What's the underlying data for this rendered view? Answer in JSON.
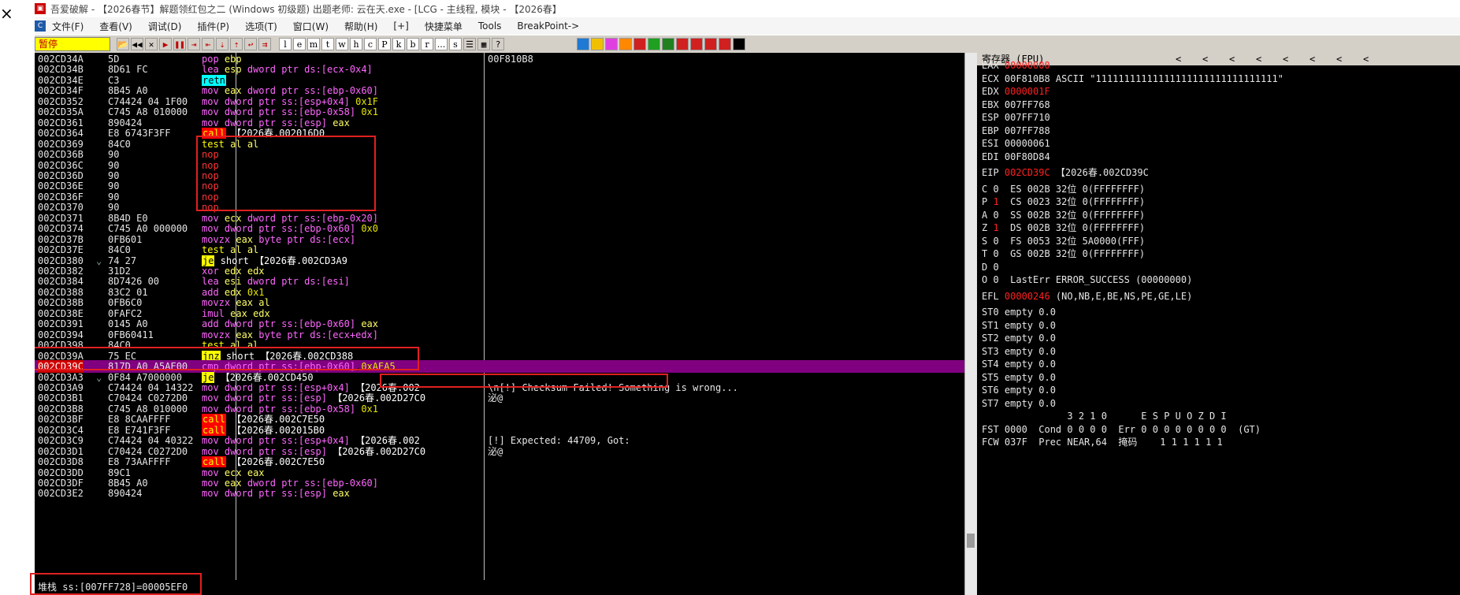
{
  "window": {
    "title": "吾爱破解 - 【2026春节】解题领红包之二 (Windows 初级题) 出题老师: 云在天.exe - [LCG - 主线程, 模块 - 【2026春】"
  },
  "left_close_glyph": "×",
  "menu": {
    "items": [
      "文件(F)",
      "查看(V)",
      "调试(D)",
      "插件(P)",
      "选项(T)",
      "窗口(W)",
      "帮助(H)",
      "[+]",
      "快捷菜单",
      "Tools",
      "BreakPoint->"
    ]
  },
  "toolbar": {
    "status": "暂停",
    "buttons": [
      "📂",
      "◀◀",
      "✕",
      "▶",
      "❚❚",
      "⇥",
      "⇤",
      "⇣",
      "⇡",
      "↩",
      "⇉"
    ],
    "letters": [
      "l",
      "e",
      "m",
      "t",
      "w",
      "h",
      "c",
      "P",
      "k",
      "b",
      "r",
      "...",
      "s"
    ],
    "extra": [
      "☰",
      "▦",
      "?"
    ]
  },
  "cpu": {
    "rows": [
      {
        "addr": "002CD34A",
        "j": "",
        "hex": "5D",
        "mn": "pop",
        "ops": "ebp",
        "cmt": "00F810B8"
      },
      {
        "addr": "002CD34B",
        "j": "",
        "hex": "8D61 FC",
        "mn": "lea",
        "ops": "esp,dword ptr ds:[ecx-0x4]",
        "cmt": ""
      },
      {
        "addr": "002CD34E",
        "j": "",
        "hex": "C3",
        "mn": "retn",
        "ops": "",
        "cmt": ""
      },
      {
        "addr": "002CD34F",
        "j": "",
        "hex": "8B45 A0",
        "mn": "mov",
        "ops": "eax,dword ptr ss:[ebp-0x60]",
        "cmt": ""
      },
      {
        "addr": "002CD352",
        "j": "",
        "hex": "C74424 04 1F00",
        "mn": "mov",
        "ops": "dword ptr ss:[esp+0x4],0x1F",
        "cmt": ""
      },
      {
        "addr": "002CD35A",
        "j": "",
        "hex": "C745 A8 010000",
        "mn": "mov",
        "ops": "dword ptr ss:[ebp-0x58],0x1",
        "cmt": ""
      },
      {
        "addr": "002CD361",
        "j": "",
        "hex": "890424",
        "mn": "mov",
        "ops": "dword ptr ss:[esp],eax",
        "cmt": ""
      },
      {
        "addr": "002CD364",
        "j": "",
        "hex": "E8 6743F3FF",
        "mn": "call",
        "ops": "【2026春.002016D0",
        "cmt": ""
      },
      {
        "addr": "002CD369",
        "j": "",
        "hex": "84C0",
        "mn": "test",
        "ops": "al,al",
        "cmt": ""
      },
      {
        "addr": "002CD36B",
        "j": "",
        "hex": "90",
        "mn": "nop",
        "ops": "",
        "cmt": ""
      },
      {
        "addr": "002CD36C",
        "j": "",
        "hex": "90",
        "mn": "nop",
        "ops": "",
        "cmt": ""
      },
      {
        "addr": "002CD36D",
        "j": "",
        "hex": "90",
        "mn": "nop",
        "ops": "",
        "cmt": ""
      },
      {
        "addr": "002CD36E",
        "j": "",
        "hex": "90",
        "mn": "nop",
        "ops": "",
        "cmt": ""
      },
      {
        "addr": "002CD36F",
        "j": "",
        "hex": "90",
        "mn": "nop",
        "ops": "",
        "cmt": ""
      },
      {
        "addr": "002CD370",
        "j": "",
        "hex": "90",
        "mn": "nop",
        "ops": "",
        "cmt": ""
      },
      {
        "addr": "002CD371",
        "j": "",
        "hex": "8B4D E0",
        "mn": "mov",
        "ops": "ecx,dword ptr ss:[ebp-0x20]",
        "cmt": ""
      },
      {
        "addr": "002CD374",
        "j": "",
        "hex": "C745 A0 000000",
        "mn": "mov",
        "ops": "dword ptr ss:[ebp-0x60],0x0",
        "cmt": ""
      },
      {
        "addr": "002CD37B",
        "j": "",
        "hex": "0FB601",
        "mn": "movzx",
        "ops": "eax,byte ptr ds:[ecx]",
        "cmt": ""
      },
      {
        "addr": "002CD37E",
        "j": "",
        "hex": "84C0",
        "mn": "test",
        "ops": "al,al",
        "cmt": ""
      },
      {
        "addr": "002CD380",
        "j": "⌄",
        "hex": "74 27",
        "mn": "je",
        "ops": "short 【2026春.002CD3A9",
        "cmt": ""
      },
      {
        "addr": "002CD382",
        "j": "",
        "hex": "31D2",
        "mn": "xor",
        "ops": "edx,edx",
        "cmt": ""
      },
      {
        "addr": "002CD384",
        "j": "",
        "hex": "8D7426 00",
        "mn": "lea",
        "ops": "esi,dword ptr ds:[esi]",
        "cmt": ""
      },
      {
        "addr": "002CD388",
        "j": "",
        "hex": "83C2 01",
        "mn": "add",
        "ops": "edx,0x1",
        "cmt": ""
      },
      {
        "addr": "002CD38B",
        "j": "",
        "hex": "0FB6C0",
        "mn": "movzx",
        "ops": "eax,al",
        "cmt": ""
      },
      {
        "addr": "002CD38E",
        "j": "",
        "hex": "0FAFC2",
        "mn": "imul",
        "ops": "eax,edx",
        "cmt": ""
      },
      {
        "addr": "002CD391",
        "j": "",
        "hex": "0145 A0",
        "mn": "add",
        "ops": "dword ptr ss:[ebp-0x60],eax",
        "cmt": ""
      },
      {
        "addr": "002CD394",
        "j": "",
        "hex": "0FB60411",
        "mn": "movzx",
        "ops": "eax,byte ptr ds:[ecx+edx]",
        "cmt": ""
      },
      {
        "addr": "002CD398",
        "j": "",
        "hex": "84C0",
        "mn": "test",
        "ops": "al,al",
        "cmt": ""
      },
      {
        "addr": "002CD39A",
        "j": "",
        "hex": "75 EC",
        "mn": "jnz",
        "ops": "short 【2026春.002CD388",
        "cmt": ""
      },
      {
        "addr": "002CD39C",
        "j": "",
        "hex": "817D A0 A5AE00",
        "mn": "cmp",
        "ops": "dword ptr ss:[ebp-0x60],0xAEA5",
        "cmt": ""
      },
      {
        "addr": "002CD3A3",
        "j": "⌄",
        "hex": "0F84 A7000000",
        "mn": "je",
        "ops": "【2026春.002CD450",
        "cmt": ""
      },
      {
        "addr": "002CD3A9",
        "j": "",
        "hex": "C74424 04 14322",
        "mn": "mov",
        "ops": "dword ptr ss:[esp+0x4],【2026春.002",
        "cmt": "\\n[!] Checksum Failed! Something is wrong..."
      },
      {
        "addr": "002CD3B1",
        "j": "",
        "hex": "C70424 C0272D0",
        "mn": "mov",
        "ops": "dword ptr ss:[esp],【2026春.002D27C0",
        "cmt": "泌@"
      },
      {
        "addr": "002CD3B8",
        "j": "",
        "hex": "C745 A8 010000",
        "mn": "mov",
        "ops": "dword ptr ss:[ebp-0x58],0x1",
        "cmt": ""
      },
      {
        "addr": "002CD3BF",
        "j": "",
        "hex": "E8 8CAAFFFF",
        "mn": "call",
        "ops": "【2026春.002C7E50",
        "cmt": ""
      },
      {
        "addr": "002CD3C4",
        "j": "",
        "hex": "E8 E741F3FF",
        "mn": "call",
        "ops": "【2026春.002015B0",
        "cmt": ""
      },
      {
        "addr": "002CD3C9",
        "j": "",
        "hex": "C74424 04 40322",
        "mn": "mov",
        "ops": "dword ptr ss:[esp+0x4],【2026春.002",
        "cmt": "[!] Expected: 44709, Got:"
      },
      {
        "addr": "002CD3D1",
        "j": "",
        "hex": "C70424 C0272D0",
        "mn": "mov",
        "ops": "dword ptr ss:[esp],【2026春.002D27C0",
        "cmt": "泌@"
      },
      {
        "addr": "002CD3D8",
        "j": "",
        "hex": "E8 73AAFFFF",
        "mn": "call",
        "ops": "【2026春.002C7E50",
        "cmt": ""
      },
      {
        "addr": "002CD3DD",
        "j": "",
        "hex": "89C1",
        "mn": "mov",
        "ops": "ecx,eax",
        "cmt": ""
      },
      {
        "addr": "002CD3DF",
        "j": "",
        "hex": "8B45 A0",
        "mn": "mov",
        "ops": "eax,dword ptr ss:[ebp-0x60]",
        "cmt": ""
      },
      {
        "addr": "002CD3E2",
        "j": "",
        "hex": "890424",
        "mn": "mov",
        "ops": "dword ptr ss:[esp],eax",
        "cmt": ""
      }
    ],
    "selected_addr": "002CD39C",
    "info_line": "堆栈 ss:[007FF728]=00005EF0"
  },
  "registers": {
    "title": "寄存器 (FPU)",
    "arrows": [
      "<",
      "<",
      "<",
      "<",
      "<",
      "<",
      "<",
      "<"
    ],
    "lines": [
      {
        "t": "EAX ",
        "v": "00000000",
        "red": true,
        "rest": ""
      },
      {
        "t": "ECX ",
        "v": "00F810B8",
        "red": false,
        "rest": " ASCII \"11111111111111111111111111111111\""
      },
      {
        "t": "EDX ",
        "v": "0000001F",
        "red": true,
        "rest": ""
      },
      {
        "t": "EBX ",
        "v": "007FF768",
        "red": false,
        "rest": ""
      },
      {
        "t": "ESP ",
        "v": "007FF710",
        "red": false,
        "rest": ""
      },
      {
        "t": "EBP ",
        "v": "007FF788",
        "red": false,
        "rest": ""
      },
      {
        "t": "ESI ",
        "v": "00000061",
        "red": false,
        "rest": ""
      },
      {
        "t": "EDI ",
        "v": "00F80D84",
        "red": false,
        "rest": ""
      },
      {
        "t": "",
        "v": "",
        "red": false,
        "rest": ""
      },
      {
        "t": "EIP ",
        "v": "002CD39C",
        "red": true,
        "rest": " 【2026春.002CD39C"
      },
      {
        "t": "",
        "v": "",
        "red": false,
        "rest": ""
      },
      {
        "t": "C 0  ",
        "v": "",
        "red": false,
        "rest": "ES 002B 32位 0(FFFFFFFF)"
      },
      {
        "t": "P ",
        "v": "1",
        "red": true,
        "rest": "  CS 0023 32位 0(FFFFFFFF)"
      },
      {
        "t": "A 0  ",
        "v": "",
        "red": false,
        "rest": "SS 002B 32位 0(FFFFFFFF)"
      },
      {
        "t": "Z ",
        "v": "1",
        "red": true,
        "rest": "  DS 002B 32位 0(FFFFFFFF)"
      },
      {
        "t": "S 0  ",
        "v": "",
        "red": false,
        "rest": "FS 0053 32位 5A0000(FFF)"
      },
      {
        "t": "T 0  ",
        "v": "",
        "red": false,
        "rest": "GS 002B 32位 0(FFFFFFFF)"
      },
      {
        "t": "D 0",
        "v": "",
        "red": false,
        "rest": ""
      },
      {
        "t": "O 0  ",
        "v": "",
        "red": false,
        "rest": "LastErr ERROR_SUCCESS (00000000)"
      },
      {
        "t": "",
        "v": "",
        "red": false,
        "rest": ""
      },
      {
        "t": "EFL ",
        "v": "00000246",
        "red": true,
        "rest": " (NO,NB,E,BE,NS,PE,GE,LE)"
      },
      {
        "t": "",
        "v": "",
        "red": false,
        "rest": ""
      },
      {
        "t": "ST0 empty 0.0",
        "v": "",
        "red": false,
        "rest": ""
      },
      {
        "t": "ST1 empty 0.0",
        "v": "",
        "red": false,
        "rest": ""
      },
      {
        "t": "ST2 empty 0.0",
        "v": "",
        "red": false,
        "rest": ""
      },
      {
        "t": "ST3 empty 0.0",
        "v": "",
        "red": false,
        "rest": ""
      },
      {
        "t": "ST4 empty 0.0",
        "v": "",
        "red": false,
        "rest": ""
      },
      {
        "t": "ST5 empty 0.0",
        "v": "",
        "red": false,
        "rest": ""
      },
      {
        "t": "ST6 empty 0.0",
        "v": "",
        "red": false,
        "rest": ""
      },
      {
        "t": "ST7 empty 0.0",
        "v": "",
        "red": false,
        "rest": ""
      },
      {
        "t": "               3 2 1 0      E S P U O Z D I",
        "v": "",
        "red": false,
        "rest": ""
      },
      {
        "t": "FST 0000  Cond 0 0 0 0  Err 0 0 0 0 0 0 0 0  (GT)",
        "v": "",
        "red": false,
        "rest": ""
      },
      {
        "t": "FCW 037F  Prec NEAR,64  掩码    1 1 1 1 1 1",
        "v": "",
        "red": false,
        "rest": ""
      }
    ]
  },
  "colors": {
    "accent_red": "#e02020",
    "selection": "#800080",
    "status_yellow": "#ffff00"
  }
}
